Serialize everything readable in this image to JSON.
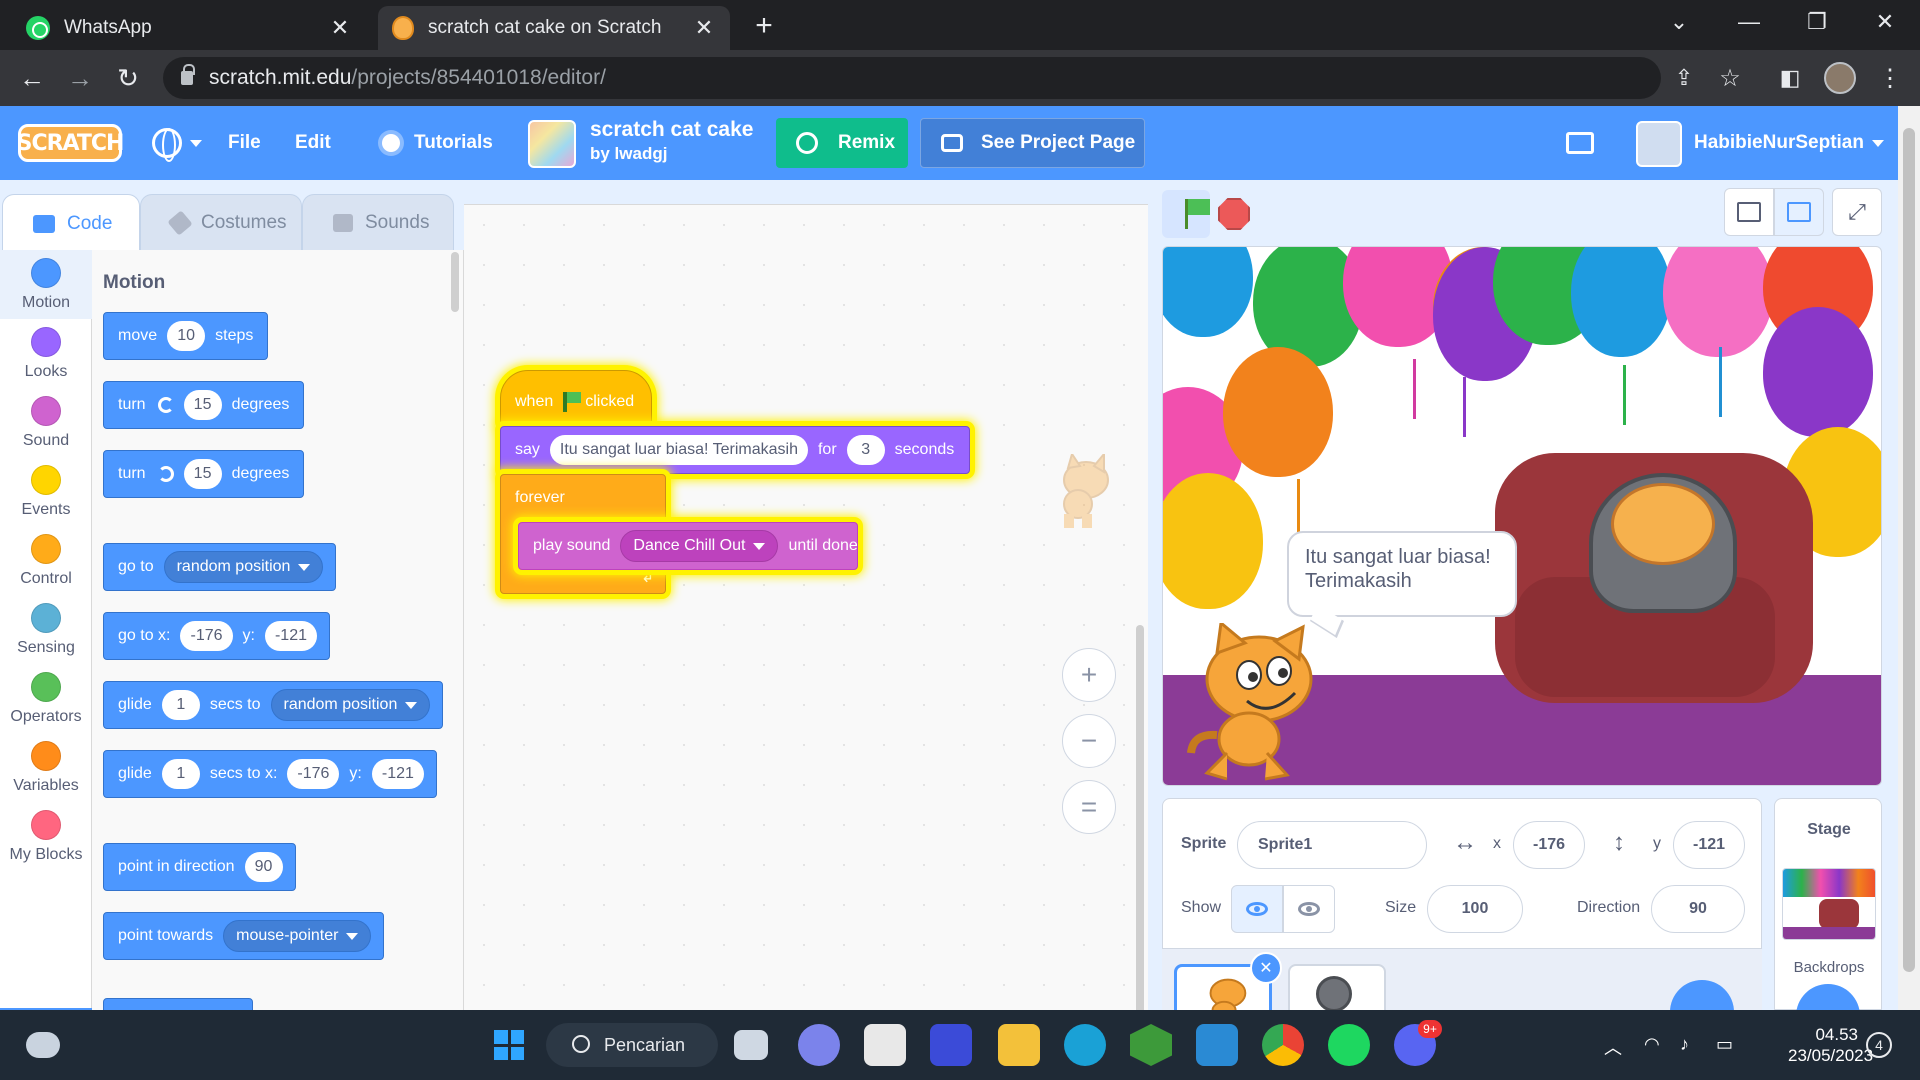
{
  "browser": {
    "tabs": [
      {
        "title": "WhatsApp",
        "active": false
      },
      {
        "title": "scratch cat cake on Scratch",
        "active": true
      }
    ],
    "new_tab": "+",
    "url_host": "scratch.mit.edu",
    "url_path": "/projects/854401018/editor/"
  },
  "menubar": {
    "logo": "SCRATCH",
    "file": "File",
    "edit": "Edit",
    "tutorials": "Tutorials",
    "project_title": "scratch cat cake",
    "project_author": "by lwadgj",
    "remix": "Remix",
    "see_project": "See Project Page",
    "username": "HabibieNurSeptian"
  },
  "editor_tabs": [
    "Code",
    "Costumes",
    "Sounds"
  ],
  "categories": [
    {
      "label": "Motion",
      "color": "#4c97ff"
    },
    {
      "label": "Looks",
      "color": "#9966ff"
    },
    {
      "label": "Sound",
      "color": "#cf63cf"
    },
    {
      "label": "Events",
      "color": "#ffd500"
    },
    {
      "label": "Control",
      "color": "#ffab19"
    },
    {
      "label": "Sensing",
      "color": "#5cb1d6"
    },
    {
      "label": "Operators",
      "color": "#59c059"
    },
    {
      "label": "Variables",
      "color": "#ff8c1a"
    },
    {
      "label": "My Blocks",
      "color": "#ff6680"
    }
  ],
  "palette": {
    "title": "Motion",
    "move": {
      "a": "move",
      "v": "10",
      "b": "steps"
    },
    "turn_right": {
      "a": "turn",
      "v": "15",
      "b": "degrees"
    },
    "turn_left": {
      "a": "turn",
      "v": "15",
      "b": "degrees"
    },
    "goto": {
      "a": "go to",
      "v": "random position"
    },
    "goto_xy": {
      "a": "go to x:",
      "x": "-176",
      "b": "y:",
      "y": "-121"
    },
    "glide_to": {
      "a": "glide",
      "v": "1",
      "b": "secs to",
      "target": "random position"
    },
    "glide_xy": {
      "a": "glide",
      "v": "1",
      "b": "secs to x:",
      "x": "-176",
      "c": "y:",
      "y": "-121"
    },
    "point_dir": {
      "a": "point in direction",
      "v": "90"
    },
    "point_towards": {
      "a": "point towards",
      "v": "mouse-pointer"
    }
  },
  "script": {
    "hat": {
      "a": "when",
      "b": "clicked"
    },
    "say": {
      "a": "say",
      "text": "Itu sangat luar biasa! Terimakasih",
      "b": "for",
      "secs": "3",
      "c": "seconds"
    },
    "forever": "forever",
    "play": {
      "a": "play sound",
      "sound": "Dance Chill Out",
      "b": "until done"
    }
  },
  "zoom": {
    "in": "+",
    "out": "−",
    "reset": "="
  },
  "stage": {
    "speech": "Itu sangat luar biasa! Terimakasih"
  },
  "sprite_info": {
    "sprite_label": "Sprite",
    "sprite_name": "Sprite1",
    "x_label": "x",
    "x": "-176",
    "y_label": "y",
    "y": "-121",
    "show_label": "Show",
    "size_label": "Size",
    "size": "100",
    "direction_label": "Direction",
    "direction": "90"
  },
  "stage_pane": {
    "title": "Stage",
    "backdrops": "Backdrops"
  },
  "taskbar": {
    "search": "Pencarian",
    "time": "04.53",
    "date": "23/05/2023",
    "notif": "4",
    "discord_badge": "9+"
  },
  "colors": {
    "scratch_blue": "#4c97ff",
    "events_yellow": "#ffbf00",
    "looks_purple": "#9966ff",
    "control_orange": "#ffab19",
    "sound_pink": "#cf63cf",
    "remix_green": "#0fbd8c"
  }
}
